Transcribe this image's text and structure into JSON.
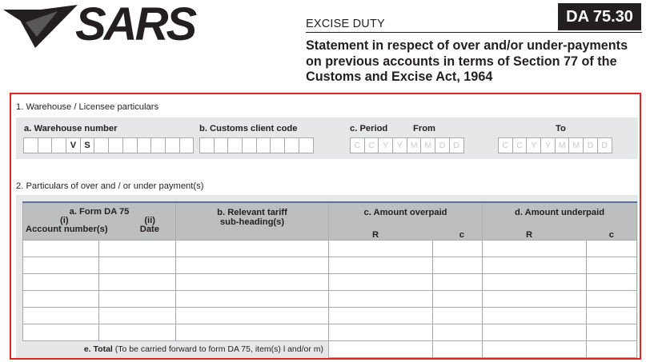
{
  "header": {
    "logo_text": "SARS",
    "category": "EXCISE DUTY",
    "form_code": "DA 75.30",
    "statement": "Statement in respect of over and/or under-payments on previous accounts in  terms of Section 77 of the Customs and Excise Act, 1964"
  },
  "section1": {
    "title": "1. Warehouse / Licensee particulars",
    "warehouse_label": "a. Warehouse number",
    "warehouse_boxes": [
      "",
      "",
      "",
      "V",
      "S",
      "",
      "",
      "",
      "",
      "",
      "",
      ""
    ],
    "client_label": "b. Customs client code",
    "client_boxes": [
      "",
      "",
      "",
      "",
      "",
      "",
      "",
      ""
    ],
    "period_label": "c. Period",
    "from_label": "From",
    "to_label": "To",
    "date_boxes": [
      "C",
      "C",
      "Y",
      "Y",
      "M",
      "M",
      "D",
      "D"
    ]
  },
  "section2": {
    "title": "2. Particulars of over and / or under payment(s)",
    "col_a_title": "a. Form DA 75",
    "col_a_i": "(i)",
    "col_a_ii": "(ii)",
    "col_a_account": "Account number(s)",
    "col_a_date": "Date",
    "col_b": "b. Relevant tariff sub-heading(s)",
    "col_c": "c. Amount overpaid",
    "col_d": "d. Amount underpaid",
    "rand": "R",
    "cents": "c",
    "total_label": "e. Total",
    "total_note": "(To be carried forward to form DA 75, item(s) l and/or m)"
  }
}
